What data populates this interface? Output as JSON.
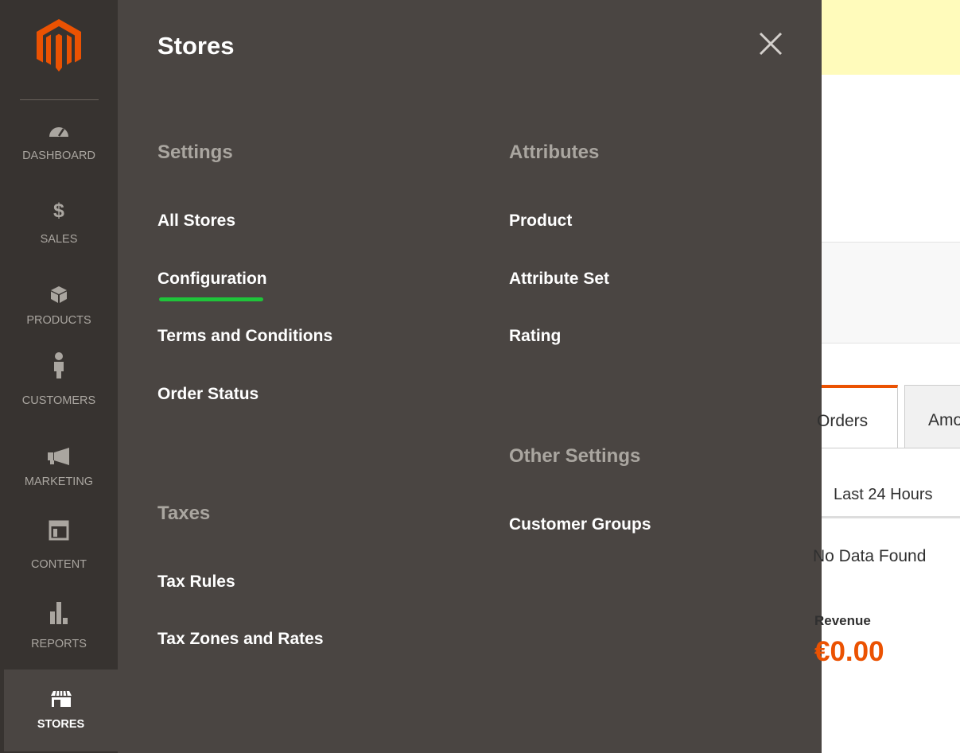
{
  "sidebar": {
    "items": [
      {
        "label": "Dashboard",
        "icon": "dashboard-icon"
      },
      {
        "label": "$",
        "icon": "dollar-icon"
      },
      {
        "label": "Sales",
        "icon": "dollar-icon"
      },
      {
        "label": "Products",
        "icon": "box-icon"
      },
      {
        "label": "Customers",
        "icon": "person-icon"
      },
      {
        "label": "Marketing",
        "icon": "megaphone-icon"
      },
      {
        "label": "Content",
        "icon": "layout-icon"
      },
      {
        "label": "Reports",
        "icon": "bar-chart-icon"
      },
      {
        "label": "Stores",
        "icon": "storefront-icon",
        "active": true
      }
    ]
  },
  "flyout": {
    "title": "Stores",
    "close_icon": "close-icon",
    "settings": {
      "title": "Settings",
      "links": [
        "All Stores",
        "Configuration",
        "Terms and Conditions",
        "Order Status"
      ]
    },
    "taxes": {
      "title": "Taxes",
      "links": [
        "Tax Rules",
        "Tax Zones and Rates"
      ]
    },
    "attributes": {
      "title": "Attributes",
      "links": [
        "Product",
        "Attribute Set",
        "Rating"
      ]
    },
    "other_settings": {
      "title": "Other Settings",
      "links": [
        "Customer Groups"
      ]
    },
    "highlighted_link": "Configuration"
  },
  "dashboard": {
    "tab_orders": "Orders",
    "tab_amounts": "Amounts",
    "period": "Last 24 Hours",
    "no_data": "No Data Found",
    "revenue_label": "Revenue",
    "revenue_value": "€0.00"
  },
  "colors": {
    "sidebar_bg": "#373330",
    "flyout_bg": "#4a4542",
    "accent": "#eb5202",
    "highlight_underline": "#1fc43a",
    "notice_bg": "#fffbbb"
  }
}
